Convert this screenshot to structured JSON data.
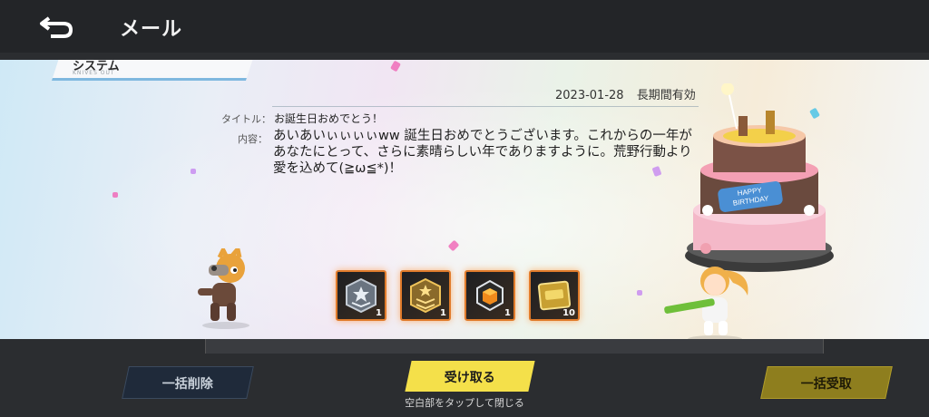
{
  "header": {
    "title": "メール"
  },
  "mail": {
    "category": "システム",
    "category_sub": "KNIVES OUT",
    "date": "2023-01-28",
    "validity": "長期間有効",
    "title_label": "タイトル：",
    "title": "お誕生日おめでとう！",
    "content_label": "内容：",
    "content": "あいあいぃぃぃぃww 誕生日おめでとうございます。これからの一年があなたにとって、さらに素晴らしい年でありますように。荒野行動より愛を込めて(≧ω≦*)！"
  },
  "rewards": [
    {
      "icon": "rank-badge-silver-icon",
      "count": "1"
    },
    {
      "icon": "rank-badge-gold-icon",
      "count": "1"
    },
    {
      "icon": "chest-box-icon",
      "count": "1"
    },
    {
      "icon": "gold-ticket-icon",
      "count": "10"
    }
  ],
  "cake_text": "HAPPY BIRTHDAY",
  "buttons": {
    "delete_all": "一括削除",
    "receive": "受け取る",
    "receive_all": "一括受取"
  },
  "hint": "空白部をタップして閉じる",
  "colors": {
    "accent_yellow": "#f4e04a",
    "reward_border": "#e07b2b"
  }
}
